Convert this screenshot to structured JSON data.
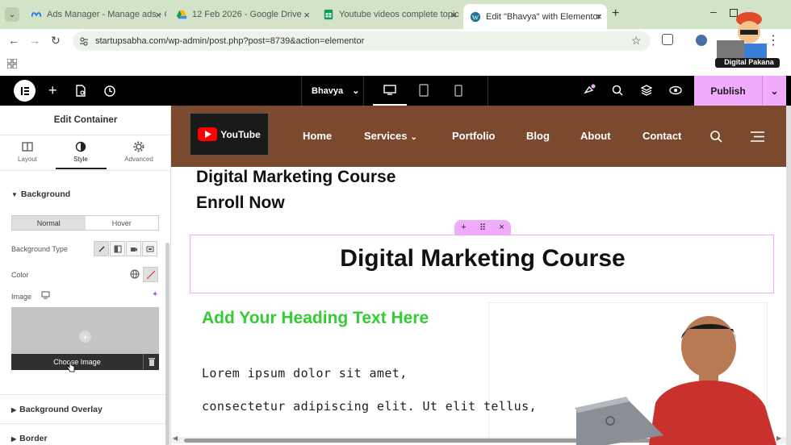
{
  "browser": {
    "tabs": [
      {
        "title": "Ads Manager - Manage ads - C",
        "icon": "meta-icon",
        "color": "#1877f2"
      },
      {
        "title": "12 Feb 2026 - Google Drive",
        "icon": "google-drive-icon",
        "color": "#fbbc04"
      },
      {
        "title": "Youtube videos complete topic",
        "icon": "google-sheets-icon",
        "color": "#0f9d58"
      },
      {
        "title": "Edit \"Bhavya\" with Elementor",
        "icon": "wordpress-icon",
        "color": "#21759b"
      }
    ],
    "url": "startupsabha.com/wp-admin/post.php?post=8739&action=elementor",
    "watermark": "Digital Pakana"
  },
  "elementor": {
    "page_name": "Bhavya",
    "publish_label": "Publish",
    "accent": "#f0abfc"
  },
  "panel": {
    "title": "Edit Container",
    "tabs": [
      {
        "label": "Layout",
        "icon": "layout-icon"
      },
      {
        "label": "Style",
        "icon": "style-icon"
      },
      {
        "label": "Advanced",
        "icon": "gear-icon"
      }
    ],
    "background_section": "Background",
    "normal_label": "Normal",
    "hover_label": "Hover",
    "background_type_label": "Background Type",
    "color_label": "Color",
    "image_label": "Image",
    "choose_image_label": "Choose Image",
    "background_overlay_section": "Background Overlay",
    "border_section": "Border"
  },
  "canvas": {
    "logo_text": "YouTube",
    "nav": [
      "Home",
      "Services",
      "Portfolio",
      "Blog",
      "About",
      "Contact"
    ],
    "heading_line1": "Digital Marketing Course",
    "heading_line2": "Enroll Now",
    "container_title": "Digital Marketing Course",
    "green_heading": "Add Your Heading Text Here",
    "green_color": "#33cc33",
    "lorem_line1": "Lorem ipsum dolor sit amet,",
    "lorem_line2": "consectetur adipiscing elit. Ut elit tellus,"
  }
}
